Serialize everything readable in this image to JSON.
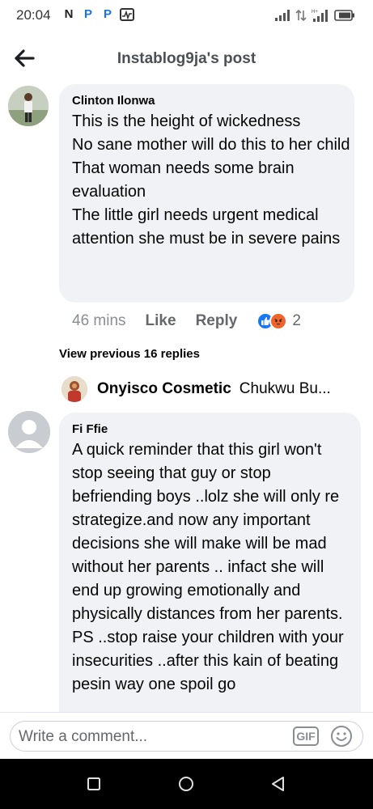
{
  "status_bar": {
    "time": "20:04",
    "left_icons": [
      "N",
      "P",
      "P"
    ],
    "right_icons": [
      "signal-icon",
      "data-icon",
      "signal-icon",
      "battery-icon"
    ]
  },
  "header": {
    "title": "Instablog9ja's post",
    "back_icon": "arrow-left-icon"
  },
  "comments": [
    {
      "author": "Clinton Ilonwa",
      "text": "This is the height of wickedness\nNo sane mother will do this to her child\nThat woman needs some brain evaluation\nThe little girl needs urgent medical attention she must be in severe pains",
      "time": "46 mins",
      "like_label": "Like",
      "reply_label": "Reply",
      "reactions": [
        "like",
        "angry"
      ],
      "reaction_count": "2"
    },
    {
      "author": "Fi Ffie",
      "text": "A quick reminder that this girl won't stop seeing that guy or stop befriending boys ..lolz she will only re strategize.and now any important decisions she will make will be mad without her parents .. infact she will end up growing emotionally and physically distances from her parents.\nPS ..stop raise your children with your insecurities ..after this kain of beating pesin way one spoil go"
    }
  ],
  "view_previous_replies": "View previous 16 replies",
  "reply_preview": {
    "name": "Onyisco Cosmetic",
    "snippet": "Chukwu Bu..."
  },
  "composer": {
    "placeholder": "Write a comment...",
    "gif_label": "GIF"
  },
  "colors": {
    "bubble": "#f0f2f5",
    "like_blue": "#1877f2",
    "angry_orange": "#f0642a"
  }
}
